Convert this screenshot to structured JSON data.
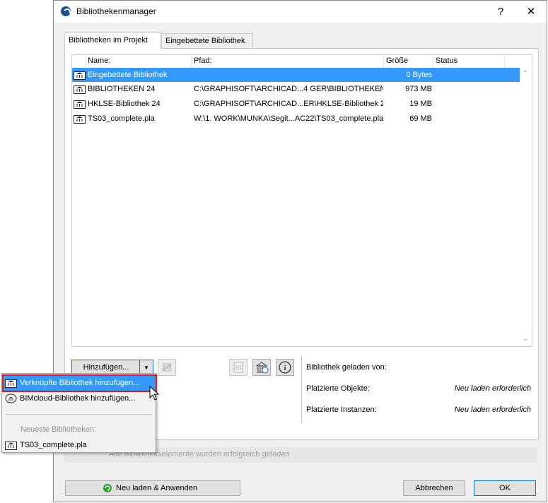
{
  "window": {
    "title": "Bibliothekenmanager",
    "help_glyph": "?",
    "close_glyph": "✕"
  },
  "tabs": [
    {
      "label": "Bibliotheken im Projekt",
      "active": true
    },
    {
      "label": "Eingebettete Bibliothek",
      "active": false
    }
  ],
  "table": {
    "columns": [
      "Name:",
      "Pfad:",
      "Größe",
      "Status"
    ],
    "rows": [
      {
        "name": "Eingebettete Bibliothek",
        "path": "",
        "size": "0 Bytes",
        "status": "",
        "selected": true
      },
      {
        "name": "BIBLIOTHEKEN 24",
        "path": "C:\\GRAPHISOFT\\ARCHICAD...4 GER\\BIBLIOTHEKEN 24",
        "size": "973 MB",
        "status": ""
      },
      {
        "name": "HKLSE-Bibliothek 24",
        "path": "C:\\GRAPHISOFT\\ARCHICAD...ER\\HKLSE-Bibliothek 24",
        "size": "19 MB",
        "status": ""
      },
      {
        "name": "TS03_complete.pla",
        "path": "W:\\1. WORK\\MUNKA\\Segit...AC22\\TS03_complete.pla",
        "size": "69 MB",
        "status": ""
      }
    ]
  },
  "toolbar": {
    "add_label": "Hinzufügen...",
    "info_glyph": "i"
  },
  "info_panel": {
    "loaded_from_label": "Bibliothek geladen von:",
    "placed_objects_label": "Platzierte Objekte:",
    "placed_objects_value": "Neu laden erforderlich",
    "placed_instances_label": "Platzierte Instanzen:",
    "placed_instances_value": "Neu laden erforderlich"
  },
  "status_message": "Alle Bibliothekselemente wurden erfolgreich geladen",
  "dropdown": {
    "items": [
      "Verknüpfte Bibliothek hinzufügen...",
      "BIMcloud-Bibliothek hinzufügen..."
    ],
    "recent_label": "Neueste Bibliotheken:",
    "recent_items": [
      "TS03_complete.pla"
    ]
  },
  "footer": {
    "reload_label": "Neu laden & Anwenden",
    "cancel_label": "Abbrechen",
    "ok_label": "OK"
  },
  "colors": {
    "selection": "#3399ff",
    "highlight_border": "#e01a1a",
    "window_bg": "#f0f0f0",
    "reload_icon": "#2aa12a"
  },
  "icons": [
    "app-icon",
    "library-icon",
    "remove-library-icon",
    "library-package-icon",
    "library-reload-icon",
    "info-icon",
    "reload-icon",
    "bimcloud-icon",
    "dropdown-arrow-icon"
  ]
}
